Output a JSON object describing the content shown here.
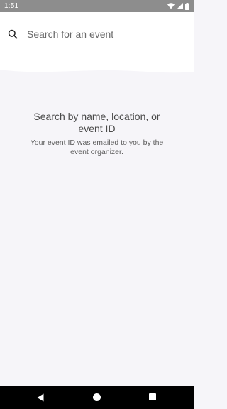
{
  "status_bar": {
    "time": "1:51",
    "icons": [
      "wifi-icon",
      "cellular-signal-icon",
      "battery-icon"
    ]
  },
  "search": {
    "placeholder": "Search for an event",
    "value": "",
    "icon": "search-icon"
  },
  "empty_state": {
    "title": "Search by name, location, or event ID",
    "subtitle": "Your event ID was emailed to you by the event organizer."
  },
  "nav_bar": {
    "icons": [
      "back-icon",
      "home-icon",
      "recents-icon"
    ]
  },
  "colors": {
    "status_bar_bg": "#8d8d8d",
    "header_bg": "#ffffff",
    "page_bg": "#f6f5f9",
    "nav_bar_bg": "#000000"
  }
}
